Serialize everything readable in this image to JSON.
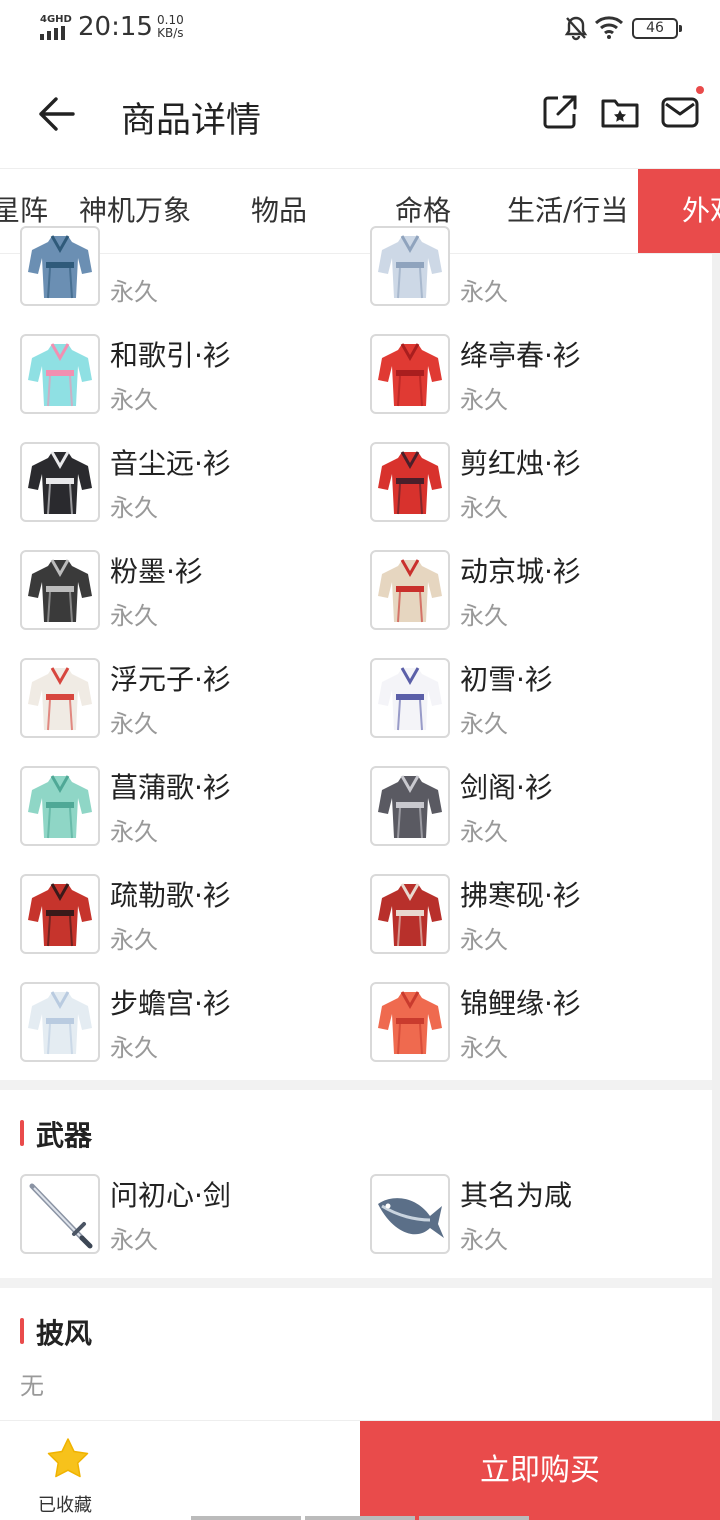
{
  "status_bar": {
    "network": "4GHD",
    "time": "20:15",
    "speed_value": "0.10",
    "speed_unit": "KB/s",
    "battery": "46"
  },
  "header": {
    "title": "商品详情",
    "icons": [
      "back-arrow-icon",
      "share-icon",
      "favorites-folder-icon",
      "mail-icon"
    ]
  },
  "tabs": [
    {
      "label": "星阵",
      "active": false
    },
    {
      "label": "神机万象",
      "active": false
    },
    {
      "label": "物品",
      "active": false
    },
    {
      "label": "命格",
      "active": false
    },
    {
      "label": "生活/行当",
      "active": false
    },
    {
      "label": "外观",
      "active": true
    }
  ],
  "outfits": [
    {
      "name": "",
      "duration": "永久",
      "colors": [
        "#6b8fb3",
        "#2f5a7a"
      ]
    },
    {
      "name": "",
      "duration": "永久",
      "colors": [
        "#cdd8e6",
        "#8fa3bd"
      ]
    },
    {
      "name": "和歌引·衫",
      "duration": "永久",
      "colors": [
        "#8fe0e3",
        "#f28fb1"
      ]
    },
    {
      "name": "绛亭春·衫",
      "duration": "永久",
      "colors": [
        "#e03a33",
        "#a91e1e"
      ]
    },
    {
      "name": "音尘远·衫",
      "duration": "永久",
      "colors": [
        "#2a2a2e",
        "#e8e8ea"
      ]
    },
    {
      "name": "剪红烛·衫",
      "duration": "永久",
      "colors": [
        "#d8322d",
        "#4a1f2a"
      ]
    },
    {
      "name": "粉墨·衫",
      "duration": "永久",
      "colors": [
        "#3a3a3a",
        "#bcbcbc"
      ]
    },
    {
      "name": "动京城·衫",
      "duration": "永久",
      "colors": [
        "#e6d6c0",
        "#c9302c"
      ]
    },
    {
      "name": "浮元子·衫",
      "duration": "永久",
      "colors": [
        "#f0ebe4",
        "#d7463e"
      ]
    },
    {
      "name": "初雪·衫",
      "duration": "永久",
      "colors": [
        "#f4f4f8",
        "#5b5fa8"
      ]
    },
    {
      "name": "菖蒲歌·衫",
      "duration": "永久",
      "colors": [
        "#8fd6c6",
        "#4fa896"
      ]
    },
    {
      "name": "剑阁·衫",
      "duration": "永久",
      "colors": [
        "#5a5a62",
        "#c9c9cf"
      ]
    },
    {
      "name": "疏勒歌·衫",
      "duration": "永久",
      "colors": [
        "#c6342c",
        "#3a1a1a"
      ]
    },
    {
      "name": "拂寒砚·衫",
      "duration": "永久",
      "colors": [
        "#b8302b",
        "#e8d9cf"
      ]
    },
    {
      "name": "步蟾宫·衫",
      "duration": "永久",
      "colors": [
        "#e4ecf2",
        "#b9cbe0"
      ]
    },
    {
      "name": "锦鲤缘·衫",
      "duration": "永久",
      "colors": [
        "#ef6a4f",
        "#c93b2e"
      ]
    }
  ],
  "weapons": {
    "title": "武器",
    "items": [
      {
        "name": "问初心·剑",
        "duration": "永久",
        "icon": "sword-icon"
      },
      {
        "name": "其名为咸",
        "duration": "永久",
        "icon": "fish-icon"
      }
    ]
  },
  "cape": {
    "title": "披风",
    "value": "无"
  },
  "bottom_bar": {
    "favorite_label": "已收藏",
    "buy_label": "立即购买"
  },
  "colors": {
    "accent": "#e94b4b",
    "star": "#f7c21b"
  }
}
